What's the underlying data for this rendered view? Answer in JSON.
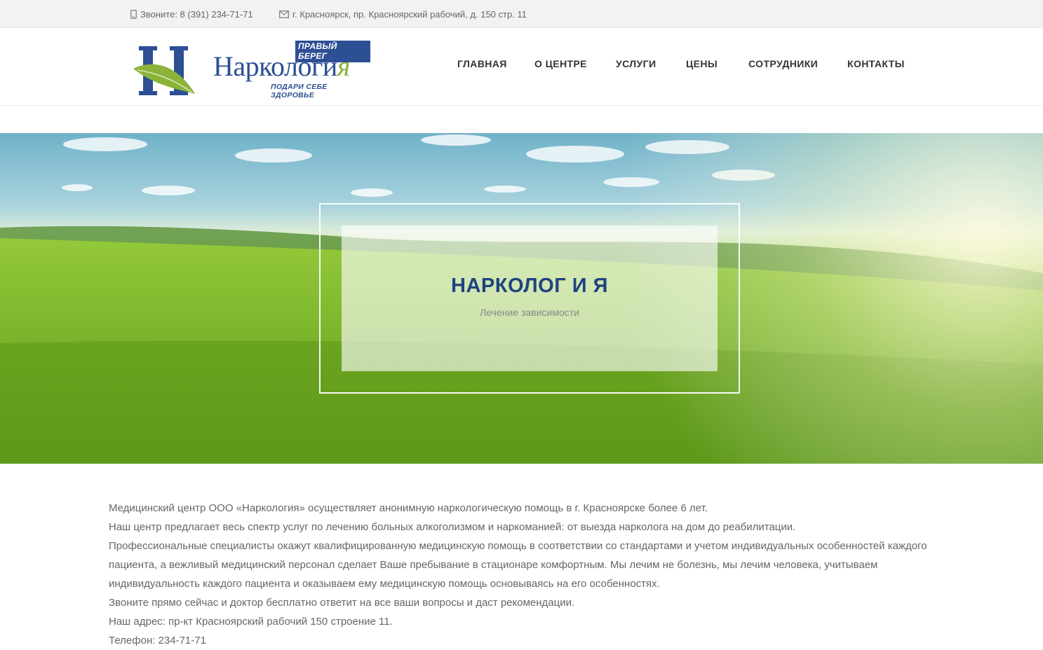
{
  "topbar": {
    "phone": "Звоните: 8 (391) 234-71-71",
    "address": "г. Красноярск, пр. Красноярский рабочий, д. 150 стр. 11",
    "phone_icon": "mobile-icon",
    "address_icon": "envelope-icon"
  },
  "logo": {
    "badge": "ПРАВЫЙ БЕРЕГ",
    "word_main": "Наркологи",
    "word_accent": "я",
    "tagline": "ПОДАРИ СЕБЕ ЗДОРОВЬЕ",
    "mark_letter": "Н"
  },
  "nav": {
    "items": [
      {
        "label": "ГЛАВНАЯ"
      },
      {
        "label": "О ЦЕНТРЕ"
      },
      {
        "label": "УСЛУГИ"
      },
      {
        "label": "ЦЕНЫ"
      },
      {
        "label": "СОТРУДНИКИ"
      },
      {
        "label": "КОНТАКТЫ"
      }
    ]
  },
  "hero": {
    "title": "НАРКОЛОГ И Я",
    "subtitle": "Лечение зависимости"
  },
  "content": {
    "lines": [
      "Медицинский центр ООО «Наркология» осуществляет анонимную наркологическую помощь в г. Красноярске более 6 лет.",
      "Наш центр предлагает весь спектр услуг по лечению больных алкоголизмом и наркоманией: от выезда нарколога на дом до реабилитации.",
      "Профессиональные специалисты окажут квалифицированную медицинскую помощь в соответствии со стандартами и учетом индивидуальных особенностей каждого пациента, а вежливый медицинский персонал сделает Ваше пребывание в стационаре комфортным. Мы лечим не болезнь, мы лечим человека, учитываем индивидуальность каждого пациента и оказываем ему медицинскую помощь основываясь на его особенностях.",
      "Звоните прямо сейчас и доктор бесплатно ответит на все ваши вопросы и даст рекомендации.",
      "Наш адрес: пр-кт Красноярский рабочий 150 строение 11.",
      "Телефон: 234-71-71"
    ]
  },
  "colors": {
    "brand_blue": "#2d4f93",
    "brand_green": "#8bb33a",
    "hero_title": "#1f4380"
  }
}
